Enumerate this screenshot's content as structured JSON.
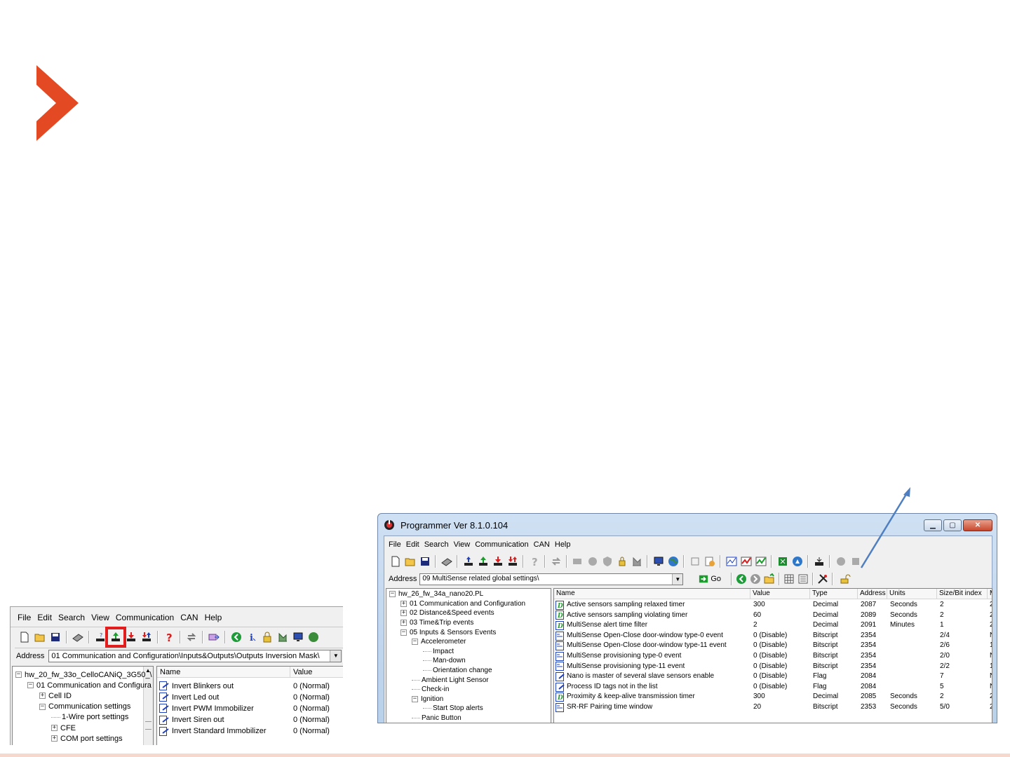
{
  "brand": {
    "logo_color": "#e34a24",
    "callout_color": "#4f7fc0"
  },
  "left_window": {
    "menu": [
      "File",
      "Edit",
      "Search",
      "View",
      "Communication",
      "CAN",
      "Help"
    ],
    "highlight_color": "#e21d1d",
    "address_label": "Address",
    "address_value": "01 Communication and Configuration\\Inputs&Outputs\\Outputs Inversion Mask\\",
    "tree": [
      {
        "label": "hw_20_fw_33o_CelloCANiQ_3G50_\\",
        "level": 0,
        "expander": "−"
      },
      {
        "label": "01 Communication and Configura",
        "level": 1,
        "expander": "−"
      },
      {
        "label": "Cell ID",
        "level": 2,
        "expander": "+"
      },
      {
        "label": "Communication settings",
        "level": 2,
        "expander": "−"
      },
      {
        "label": "1-Wire port settings",
        "level": 3,
        "expander": ""
      },
      {
        "label": "CFE",
        "level": 3,
        "expander": "+"
      },
      {
        "label": "COM port settings",
        "level": 3,
        "expander": "+"
      }
    ],
    "columns": [
      "Name",
      "Value"
    ],
    "rows": [
      {
        "name": "Invert Blinkers out",
        "value": "0 (Normal)"
      },
      {
        "name": "Invert Led out",
        "value": "0 (Normal)"
      },
      {
        "name": "Invert PWM Immobilizer",
        "value": "0 (Normal)"
      },
      {
        "name": "Invert Siren out",
        "value": "0 (Normal)"
      },
      {
        "name": "Invert Standard Immobilizer",
        "value": "0 (Normal)"
      }
    ]
  },
  "right_window": {
    "title": "Programmer  Ver 8.1.0.104",
    "menu": [
      "File",
      "Edit",
      "Search",
      "View",
      "Communication",
      "CAN",
      "Help"
    ],
    "address_label": "Address",
    "address_value": "09 MultiSense related global settings\\",
    "go_label": "Go",
    "tree": [
      {
        "label": "hw_26_fw_34a_nano20.PL",
        "level": 0,
        "expander": "−"
      },
      {
        "label": "01 Communication and Configuration",
        "level": 1,
        "expander": "+"
      },
      {
        "label": "02 Distance&Speed events",
        "level": 1,
        "expander": "+"
      },
      {
        "label": "03 Time&Trip events",
        "level": 1,
        "expander": "+"
      },
      {
        "label": "05 Inputs & Sensors Events",
        "level": 1,
        "expander": "−"
      },
      {
        "label": "Accelerometer",
        "level": 2,
        "expander": "−"
      },
      {
        "label": "Impact",
        "level": 3,
        "expander": ""
      },
      {
        "label": "Man-down",
        "level": 3,
        "expander": ""
      },
      {
        "label": "Orientation change",
        "level": 3,
        "expander": ""
      },
      {
        "label": "Ambient Light Sensor",
        "level": 2,
        "expander": ""
      },
      {
        "label": "Check-in",
        "level": 2,
        "expander": ""
      },
      {
        "label": "Ignition",
        "level": 2,
        "expander": "−"
      },
      {
        "label": "Start Stop alerts",
        "level": 3,
        "expander": ""
      },
      {
        "label": "Panic Button",
        "level": 2,
        "expander": ""
      }
    ],
    "columns": [
      "Name",
      "Value",
      "Type",
      "Address",
      "Units",
      "Size/Bit index",
      "M"
    ],
    "rows": [
      {
        "icon": "d",
        "name": "Active sensors sampling relaxed timer",
        "value": "300",
        "type": "Decimal",
        "address": "2087",
        "units": "Seconds",
        "size": "2",
        "m": "2"
      },
      {
        "icon": "d",
        "name": "Active sensors sampling violating timer",
        "value": "60",
        "type": "Decimal",
        "address": "2089",
        "units": "Seconds",
        "size": "2",
        "m": "2"
      },
      {
        "icon": "d",
        "name": "MultiSense alert time filter",
        "value": "2",
        "type": "Decimal",
        "address": "2091",
        "units": "Minutes",
        "size": "1",
        "m": "2"
      },
      {
        "icon": "b",
        "name": "MultiSense Open-Close door-window type-0 event",
        "value": "0 (Disable)",
        "type": "Bitscript",
        "address": "2354",
        "units": "",
        "size": "2/4",
        "m": "N"
      },
      {
        "icon": "b",
        "name": "MultiSense Open-Close door-window type-11 event",
        "value": "0 (Disable)",
        "type": "Bitscript",
        "address": "2354",
        "units": "",
        "size": "2/6",
        "m": "1"
      },
      {
        "icon": "b",
        "name": "MultiSense provisioning type-0 event",
        "value": "0 (Disable)",
        "type": "Bitscript",
        "address": "2354",
        "units": "",
        "size": "2/0",
        "m": "N"
      },
      {
        "icon": "b",
        "name": "MultiSense provisioning type-11 event",
        "value": "0 (Disable)",
        "type": "Bitscript",
        "address": "2354",
        "units": "",
        "size": "2/2",
        "m": "1"
      },
      {
        "icon": "f",
        "name": "Nano is master of several slave sensors enable",
        "value": "0 (Disable)",
        "type": "Flag",
        "address": "2084",
        "units": "",
        "size": "7",
        "m": "N"
      },
      {
        "icon": "f",
        "name": "Process ID tags not in the list",
        "value": "0 (Disable)",
        "type": "Flag",
        "address": "2084",
        "units": "",
        "size": "5",
        "m": "N"
      },
      {
        "icon": "d",
        "name": "Proximity & keep-alive transmission timer",
        "value": "300",
        "type": "Decimal",
        "address": "2085",
        "units": "Seconds",
        "size": "2",
        "m": "2"
      },
      {
        "icon": "b",
        "name": "SR-RF Pairing time window",
        "value": "20",
        "type": "Bitscript",
        "address": "2353",
        "units": "Seconds",
        "size": "5/0",
        "m": "2"
      }
    ]
  },
  "icons": [
    "new-file-icon",
    "open-folder-icon",
    "save-icon",
    "device-icon",
    "upload-icon",
    "download-icon",
    "help-icon",
    "refresh-icon",
    "info-icon",
    "lock-icon",
    "monitor-icon",
    "globe-icon",
    "back-icon",
    "forward-icon"
  ]
}
